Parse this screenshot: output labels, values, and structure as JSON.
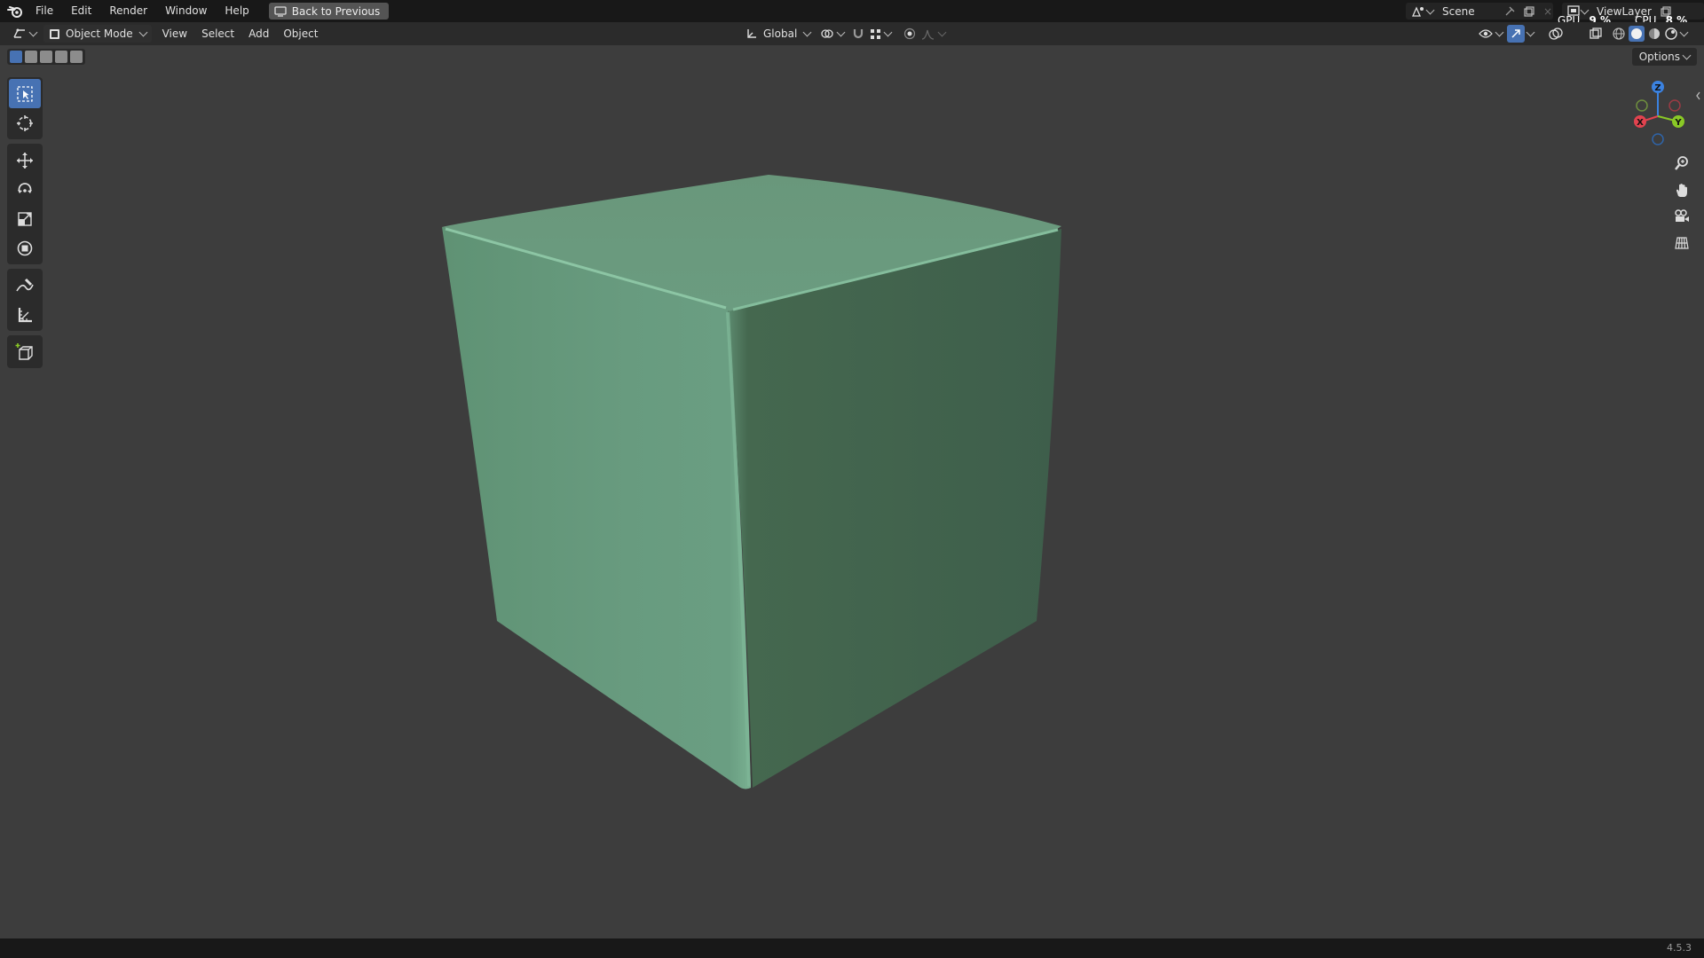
{
  "menu": {
    "file": "File",
    "edit": "Edit",
    "render": "Render",
    "window": "Window",
    "help": "Help",
    "back_to_previous": "Back to Previous"
  },
  "scene": {
    "name": "Scene"
  },
  "view_layer": {
    "name": "ViewLayer"
  },
  "stats": {
    "gpu_label": "GPU",
    "gpu_value": "9 %",
    "cpu_label": "CPU",
    "cpu_value": "8 %"
  },
  "header": {
    "mode": "Object Mode",
    "view": "View",
    "select": "Select",
    "add": "Add",
    "object": "Object",
    "orientation": "Global"
  },
  "options": {
    "label": "Options"
  },
  "gizmo": {
    "z": "Z",
    "x": "X",
    "y": "Y"
  },
  "version": "4.5.3",
  "colors": {
    "accent": "#4772b3",
    "cube_light": "#679a7e",
    "cube_dark": "#40604d",
    "viewport": "#3d3d3d",
    "axis_x": "#e2434f",
    "axis_y": "#8ac926",
    "axis_z": "#3b82e0"
  }
}
